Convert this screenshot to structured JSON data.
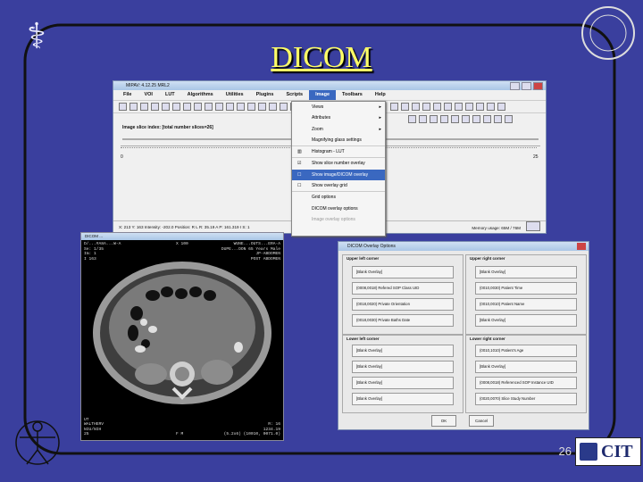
{
  "slide": {
    "title": "DICOM",
    "page_number": "26",
    "cit_logo_text": "CIT"
  },
  "mipav": {
    "window_title": "MIPAV: 4.12.25 MRL2",
    "menus": [
      "File",
      "VOI",
      "LUT",
      "Algorithms",
      "Utilities",
      "Plugins",
      "Scripts",
      "Image",
      "Toolbars",
      "Help"
    ],
    "active_menu": "Image",
    "slice_label": "Image slice index: [total number slices=26]",
    "slider_min": "0",
    "slider_max": "25",
    "status": "X: 213 Y: 163 Intensity: -202.0 Position: R L R: 35.19 A P: 161.319 I S: 1",
    "memory": "Memory usage: 65M / 76M"
  },
  "image_menu": {
    "items": [
      {
        "label": "Views",
        "submenu": true
      },
      {
        "label": "Attributes",
        "submenu": true
      },
      {
        "label": "Zoom",
        "submenu": true
      },
      {
        "label": "Magnifying glass settings"
      },
      {
        "label": "Histogram - LUT",
        "sep": true
      },
      {
        "label": "Show slice number overlay",
        "sep": true,
        "checked": true
      },
      {
        "label": "Show image/DICOM overlay",
        "highlighted": true
      },
      {
        "label": "Show overlay grid"
      },
      {
        "label": "Grid options",
        "sep": true
      },
      {
        "label": "DICOM overlay options"
      },
      {
        "label": "Image overlay options",
        "disabled": true
      }
    ]
  },
  "ct_window": {
    "title": "DICOM ...",
    "top_left": [
      "D/...#A8A...W-A",
      "Se: 1/35",
      "Im: 1",
      "",
      "I 163"
    ],
    "top_right": [
      "WUNE...OUTS...ERA-A",
      "DUPE...DON  65 Years Male",
      "JP-ABDOMEN",
      "POST ABDOMEN"
    ],
    "top_center": "X 100",
    "bottom_left": [
      "UT",
      "WALTHERV",
      "NIU/NIH",
      "",
      "25"
    ],
    "bottom_right": [
      "R: 16",
      "1234.19",
      "(5.2x6) (10010, 0071.0)"
    ],
    "bottom_center": "F  M"
  },
  "overlay_dialog": {
    "title": "DICOM Overlay Options",
    "upper_left_header": "Upper left corner",
    "upper_right_header": "Upper right corner",
    "lower_left_header": "Lower left corner",
    "lower_right_header": "Lower right corner",
    "upper_left": [
      "[Blank Overlay]",
      "(0008,0018) Refered SOP Class UID",
      "(0018,0020) Private Orientation",
      "(0018,0030) Private Baths Date"
    ],
    "upper_right": [
      "[Blank Overlay]",
      "(0010,0030) Patient Time",
      "(0010,0010) Patient Name",
      "[Blank Overlay]"
    ],
    "lower_left": [
      "[Blank Overlay]",
      "[Blank Overlay]",
      "[Blank Overlay]",
      "[Blank Overlay]"
    ],
    "lower_right": [
      "(0010,1010) Patient's Age",
      "[Blank Overlay]",
      "(0008,0018) Referenced SOP Instance UID",
      "(0020,0070) Slice Study Number"
    ],
    "ok_label": "OK",
    "cancel_label": "Cancel"
  }
}
